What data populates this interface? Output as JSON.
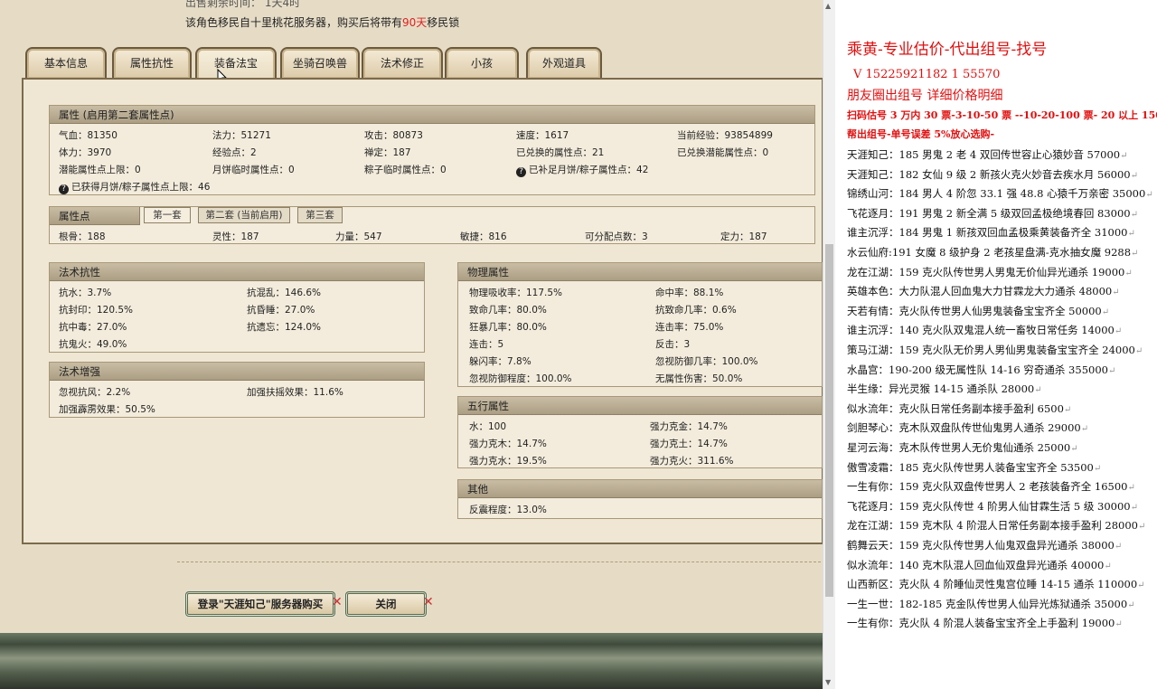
{
  "game": {
    "top_cut_text": "出售剩余时间：  1天4时",
    "notice_pre": "该角色移民自十里桃花服务器，购买后将带有",
    "notice_days": "90天",
    "notice_post": "移民锁",
    "tabs": [
      "基本信息",
      "属性抗性",
      "装备法宝",
      "坐骑召唤兽",
      "法术修正",
      "小孩",
      "外观道具"
    ],
    "attr_header": "属性 (启用第二套属性点)",
    "attrs": [
      [
        "气血：81350",
        "法力：51271",
        "攻击：80873",
        "速度：1617",
        "当前经验：93854899"
      ],
      [
        "体力：3970",
        "经验点：2",
        "禅定：187",
        "已兑换的属性点：21",
        "已兑换潜能属性点：0"
      ],
      [
        "潜能属性点上限：0",
        "月饼临时属性点：0",
        "粽子临时属性点：0",
        "已补足月饼/粽子属性点：42"
      ]
    ],
    "attr_last": "已获得月饼/粽子属性点上限：46",
    "points_header": "属性点",
    "points_tabs": [
      "第一套",
      "第二套 (当前启用)",
      "第三套"
    ],
    "points": [
      "根骨：188",
      "灵性：187",
      "力量：547",
      "敏捷：816",
      "可分配点数：3",
      "定力：187"
    ],
    "spell_resist": {
      "header": "法术抗性",
      "items": [
        "抗水：3.7%",
        "抗混乱：146.6%",
        "抗封印：120.5%",
        "抗昏睡：27.0%",
        "抗中毒：27.0%",
        "抗遗忘：124.0%",
        "抗鬼火：49.0%"
      ]
    },
    "spell_boost": {
      "header": "法术增强",
      "items": [
        "忽视抗风：2.2%",
        "加强扶摇效果：11.6%",
        "加强霹雳效果：50.5%"
      ]
    },
    "physical": {
      "header": "物理属性",
      "items": [
        "物理吸收率：117.5%",
        "命中率：88.1%",
        "致命几率：80.0%",
        "抗致命几率：0.6%",
        "狂暴几率：80.0%",
        "连击率：75.0%",
        "连击：5",
        "反击：3",
        "躲闪率：7.8%",
        "忽视防御几率：100.0%",
        "忽视防御程度：100.0%",
        "无属性伤害：50.0%"
      ]
    },
    "five": {
      "header": "五行属性",
      "items": [
        "水：100",
        "强力克金：14.7%",
        "强力克木：14.7%",
        "强力克土：14.7%",
        "强力克水：19.5%",
        "强力克火：311.6%"
      ]
    },
    "other": {
      "header": "其他",
      "items": [
        "反震程度：13.0%"
      ]
    },
    "buy_button": "登录\"天涯知己\"服务器购买",
    "close_button": "关闭"
  },
  "side": {
    "title": "乘黄-专业估价-代出组号-找号",
    "phone": "V 15225921182   1    55570",
    "moments": "朋友圈出组号    详细价格明细",
    "note1": "扫码估号 3 万内 30 票-3-10-50 票  --10-20-100 票- 20 以上 150",
    "note2": "帮出组号-单号误差 5%放心选购-",
    "listings": [
      "天涯知己：185 男鬼 2 老 4 双回传世容止心猿妙音 57000",
      "天涯知己：182 女仙 9 级 2 新孩火克火妙音去疾水月 56000",
      "锦绣山河：184 男人 4 阶忽 33.1 强 48.8 心猿千万亲密 35000",
      "飞花逐月：191 男鬼 2 新全满 5 级双回孟极绝境春回 83000",
      "谁主沉浮：184 男鬼 1 新孩双回血孟极乘黄装备齐全 31000",
      "水云仙府:191 女魔 8 级护身 2 老孩星盘满-克水抽女魔 9288",
      "龙在江湖：159 克火队传世男人男鬼无价仙异光通杀 19000",
      "英雄本色：大力队混人回血鬼大力甘霖龙大力通杀 48000",
      "天若有情：克火队传世男人仙男鬼装备宝宝齐全 50000",
      "谁主沉浮：140 克火队双鬼混人统一畜牧日常任务 14000",
      "策马江湖：159 克火队无价男人男仙男鬼装备宝宝齐全 24000",
      "水晶宫：190-200 级无属性队 14-16 穷奇通杀 355000",
      "半生缘：异光灵猴 14-15 通杀队 28000",
      "似水流年：克火队日常任务副本接手盈利 6500",
      "剑胆琴心：克木队双盘队传世仙鬼男人通杀 29000",
      "星河云海：克木队传世男人无价鬼仙通杀 25000",
      "傲雪凌霜：185 克火队传世男人装备宝宝齐全 53500",
      "一生有你：159 克火队双盘传世男人 2 老孩装备齐全 16500",
      "飞花逐月：159 克火队传世 4 阶男人仙甘霖生活 5 级 30000",
      "龙在江湖：159 克木队 4 阶混人日常任务副本接手盈利 28000",
      "鹤舞云天：159 克火队传世男人仙鬼双盘异光通杀 38000",
      "似水流年：140 克木队混人回血仙双盘异光通杀 40000",
      "山西新区：克火队 4 阶睡仙灵性鬼宫位睡 14-15 通杀 110000",
      "一生一世：182-185 克金队传世男人仙异光炼狱通杀 35000",
      "一生有你：克火队 4 阶混人装备宝宝齐全上手盈利 19000"
    ]
  }
}
